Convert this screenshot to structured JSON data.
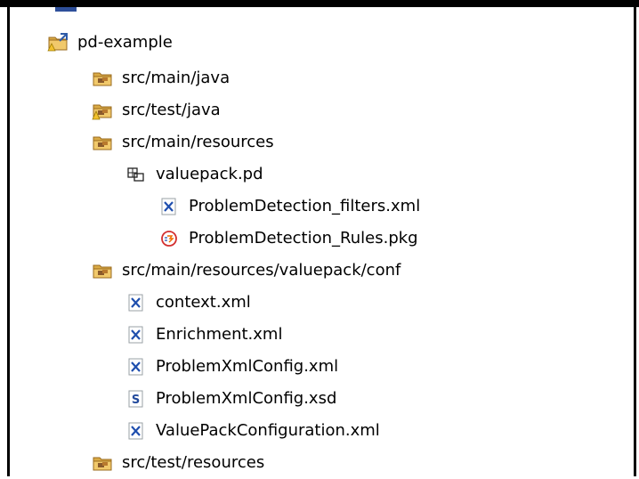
{
  "tree": {
    "project": {
      "label": "pd-example",
      "icon": "project-folder-icon"
    },
    "src_main_java": {
      "label": "src/main/java",
      "icon": "package-folder-icon"
    },
    "src_test_java": {
      "label": "src/test/java",
      "icon": "package-folder-warning-icon"
    },
    "src_main_resources": {
      "label": "src/main/resources",
      "icon": "package-folder-icon"
    },
    "valuepack_pd": {
      "label": "valuepack.pd",
      "icon": "package-icon"
    },
    "problem_detection_filters": {
      "label": "ProblemDetection_filters.xml",
      "icon": "xml-file-icon"
    },
    "problem_detection_rules": {
      "label": "ProblemDetection_Rules.pkg",
      "icon": "rules-package-icon"
    },
    "src_main_resources_conf": {
      "label": "src/main/resources/valuepack/conf",
      "icon": "package-folder-icon"
    },
    "context_xml": {
      "label": "context.xml",
      "icon": "xml-file-icon"
    },
    "enrichment_xml": {
      "label": "Enrichment.xml",
      "icon": "xml-file-icon"
    },
    "problem_xml_config_xml": {
      "label": "ProblemXmlConfig.xml",
      "icon": "xml-file-icon"
    },
    "problem_xml_config_xsd": {
      "label": "ProblemXmlConfig.xsd",
      "icon": "schema-file-icon"
    },
    "value_pack_configuration": {
      "label": "ValuePackConfiguration.xml",
      "icon": "xml-file-icon"
    },
    "src_test_resources": {
      "label": "src/test/resources",
      "icon": "package-folder-icon"
    }
  },
  "colors": {
    "folder_fill": "#d9aa45",
    "folder_dark": "#9a6b1f",
    "xml_blue": "#1f4fae",
    "schema_blue": "#234a9c",
    "warning_yellow": "#f2c12e",
    "rules_red": "#d32f2f"
  }
}
